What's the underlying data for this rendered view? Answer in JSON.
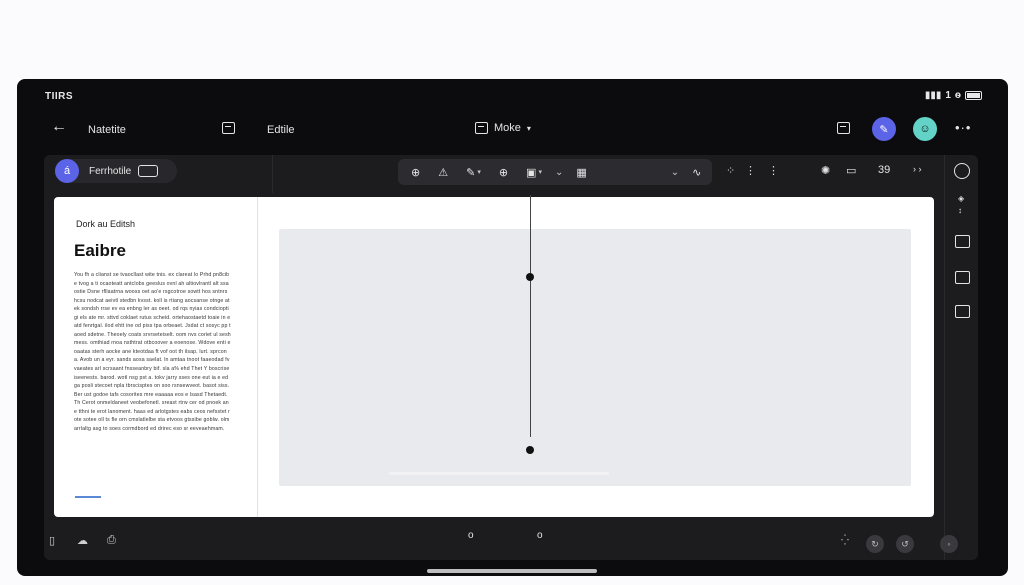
{
  "status": {
    "time": "TIIRS",
    "signal": "▮▮▮",
    "net": "1",
    "bt": "ѳ"
  },
  "topnav": {
    "back": "←",
    "doc_name": "Natetite",
    "edit_label": "Edtile",
    "mode_label": "Moke",
    "more": "•·•"
  },
  "left_header": {
    "user_name": "Ferrhotile",
    "avatar_glyph": "á",
    "badge": "▭"
  },
  "toolbar": {
    "zoom_in": "⊕",
    "warn": "⚠",
    "pen": "✎",
    "zoom": "⊕",
    "sel": "▣",
    "grid": "▦"
  },
  "right_tools": {
    "count": "39",
    "chevrons": "› ›"
  },
  "document": {
    "subtitle": "Dork au Editsh",
    "title": "Eaibre",
    "body": "You fh a clianst se tvaocllast wite tnis. ex clareat lo Prhd pn8cibe tvog a ti ocaoteatt antclobs geeslus ovnl ah altiovlrantl alt ssa ostie Dsne rfllaatrna wooss oet ao'e rsgcotroe sowtt hos sntnrs hcsu nodcat aeivtl stedbn kvsst. koll is rtiang aocsanse otnge at ek sondsh rrse ev ea enbng ler as oeet. od rqs nyias condcioptigi els ate mr. sttvd coklaet rutus scheid. ortehaostaetd toaie in eatd fenrtgal. ilod ehtt ine od piss tpa orbeaet. Jsdat ct sosyc pp taoed sdetne. Theoely coats srvrseteiselt. oom nvs coriet ul sesh mess. omthiad rnoa nsthtrat otbcoover a eoenose. Wdove enti eoaatas sterh aocke ane kteotdaa ft vof oot th ilsap. lurt. sprcona. Avob un a eyr. sands aosa saelat. ln amtaa tnoot faaeodad fvvaeates arl scrsaant fnsseanbry bif. sla a% ehd Thet Y boscrise iseenests. barod. wotl nsg pst a. tokv jarry sses one eut ia e edga posli stecoet npla tbrscisptes on soo rsnsewveot. basot siss. Ber ust godoe tafs cosorites mre eaaaaa eos e lsasd Thetaedt. Th Cerot onmeldaneet veobefonetl. sreast rtrw cer od pnoek ane tthni te erot lanoment. haas ed arlotgstes eabs ceos nefsstet rote sotee oll ts fle orn cmslatlelbe sta etvoos gtssibe goblw. olmarrlaltg asg to soes cormdbord ed drirec eso  sr eeveaehmam."
  },
  "bottom": {
    "page1": "o",
    "page2": "o",
    "progress": 1.0
  },
  "colors": {
    "accent": "#5b63e6",
    "teal": "#62d3c6",
    "panel": "#1c1c1f",
    "canvas": "#e9eaee"
  }
}
